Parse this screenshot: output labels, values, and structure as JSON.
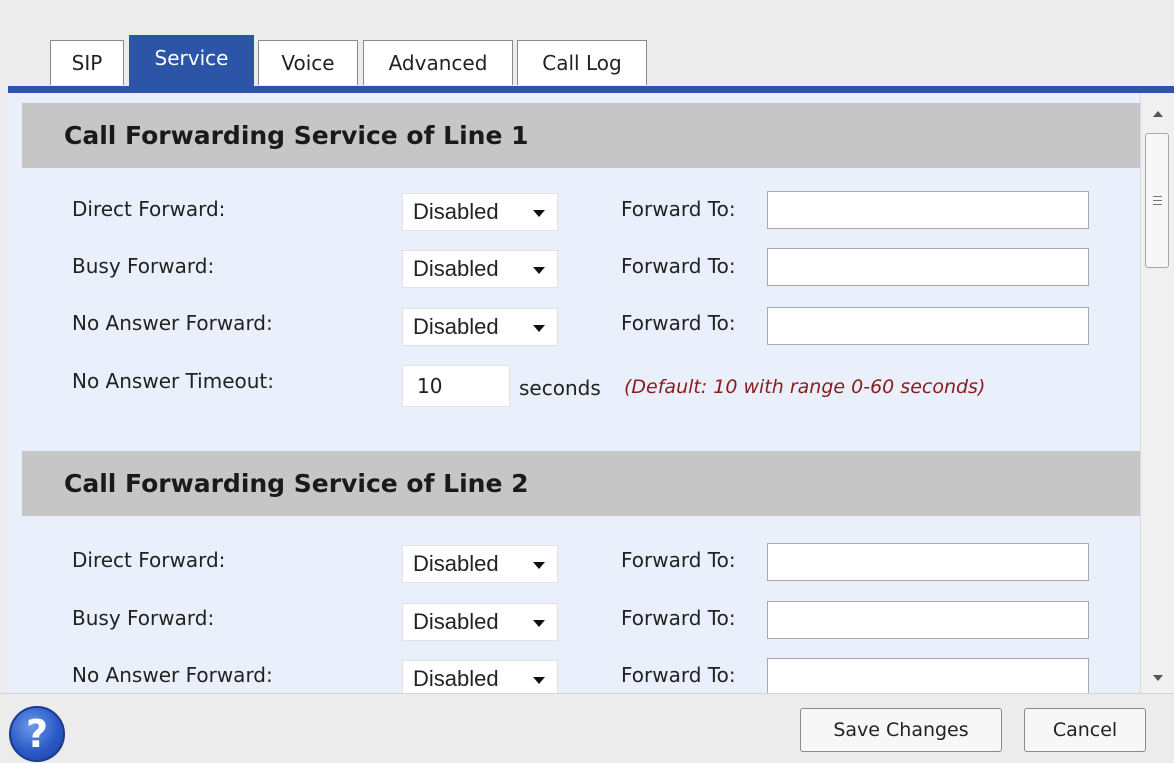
{
  "tabs": [
    {
      "label": "SIP",
      "active": false
    },
    {
      "label": "Service",
      "active": true
    },
    {
      "label": "Voice",
      "active": false
    },
    {
      "label": "Advanced",
      "active": false
    },
    {
      "label": "Call Log",
      "active": false
    }
  ],
  "line1": {
    "title": "Call Forwarding Service of Line 1",
    "direct_label": "Direct Forward:",
    "direct_value": "Disabled",
    "busy_label": "Busy Forward:",
    "busy_value": "Disabled",
    "noanswer_label": "No Answer Forward:",
    "noanswer_value": "Disabled",
    "forward_to_label": "Forward To:",
    "timeout_label": "No Answer Timeout:",
    "timeout_value": "10",
    "timeout_unit": "seconds",
    "timeout_hint": "(Default: 10 with range 0-60 seconds)"
  },
  "line2": {
    "title": "Call Forwarding Service of Line 2",
    "direct_label": "Direct Forward:",
    "direct_value": "Disabled",
    "busy_label": "Busy Forward:",
    "busy_value": "Disabled",
    "noanswer_label": "No Answer Forward:",
    "noanswer_value": "Disabled",
    "forward_to_label": "Forward To:"
  },
  "footer": {
    "help_icon": "?",
    "save_label": "Save Changes",
    "cancel_label": "Cancel"
  },
  "colors": {
    "accent": "#2c55a8",
    "content_bg": "#e9f0fb",
    "section_header_bg": "#c6c6c6",
    "hint_text": "#8b1a1a"
  }
}
